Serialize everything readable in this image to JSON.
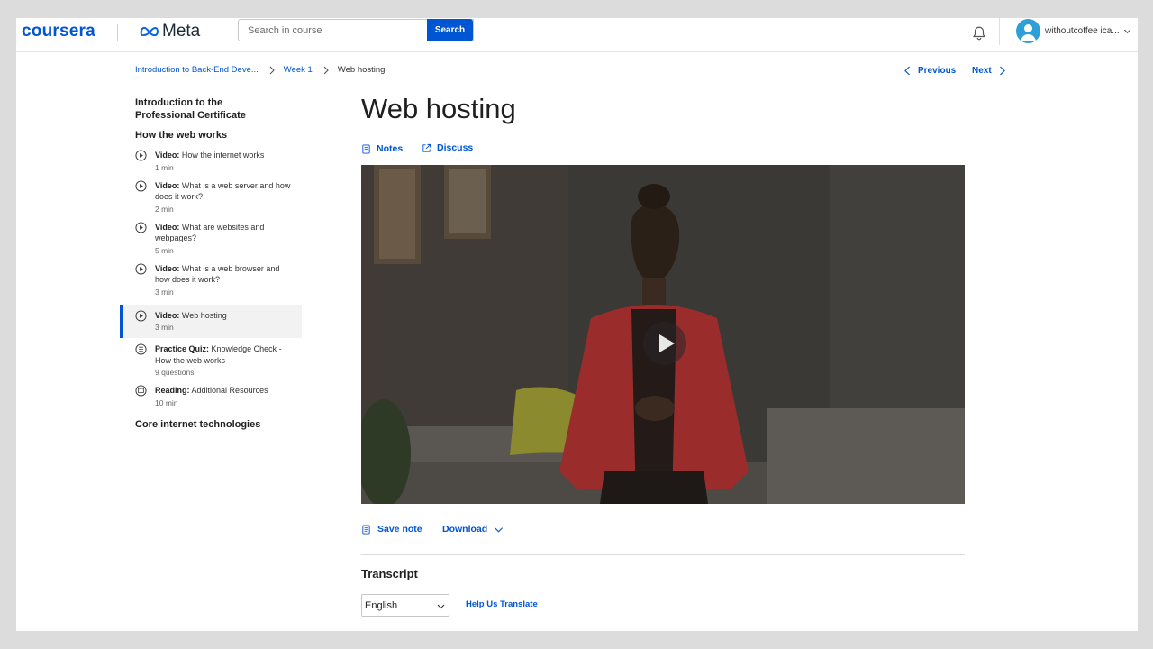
{
  "header": {
    "brand": "coursera",
    "partner": "Meta",
    "search_placeholder": "Search in course",
    "search_button": "Search",
    "username": "withoutcoffee ica..."
  },
  "breadcrumb": {
    "course": "Introduction to Back-End Deve...",
    "week": "Week 1",
    "current": "Web hosting"
  },
  "nav": {
    "previous": "Previous",
    "next": "Next"
  },
  "sidebar": {
    "section_intro": "Introduction to the Professional Certificate",
    "section_web": "How the web works",
    "items": [
      {
        "type": "Video:",
        "title": "How the internet works",
        "meta": "1 min",
        "icon": "play-circle-icon"
      },
      {
        "type": "Video:",
        "title": "What is a web server and how does it work?",
        "meta": "2 min",
        "icon": "play-circle-icon"
      },
      {
        "type": "Video:",
        "title": "What are websites and webpages?",
        "meta": "5 min",
        "icon": "play-circle-icon"
      },
      {
        "type": "Video:",
        "title": "What is a web browser and how does it work?",
        "meta": "3 min",
        "icon": "play-circle-icon"
      },
      {
        "type": "Video:",
        "title": "Web hosting",
        "meta": "3 min",
        "icon": "play-circle-icon",
        "active": true
      },
      {
        "type": "Practice Quiz:",
        "title": "Knowledge Check - How the web works",
        "meta": "9 questions",
        "icon": "quiz-icon"
      },
      {
        "type": "Reading:",
        "title": "Additional Resources",
        "meta": "10 min",
        "icon": "book-icon"
      }
    ],
    "section_core": "Core internet technologies"
  },
  "main": {
    "title": "Web hosting",
    "notes": "Notes",
    "discuss": "Discuss",
    "save_note": "Save note",
    "download": "Download",
    "transcript_title": "Transcript",
    "language": "English",
    "help_translate": "Help Us Translate"
  },
  "colors": {
    "accent": "#0056d2",
    "active_bg": "#f2f2f2",
    "avatar": "#2f9fd8"
  }
}
